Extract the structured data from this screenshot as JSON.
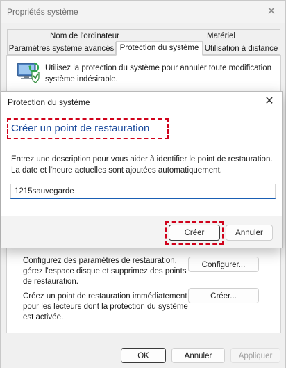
{
  "back_window": {
    "title": "Propriétés système",
    "tabs_row1": [
      "Nom de l'ordinateur",
      "Matériel"
    ],
    "tabs_row2": [
      "Paramètres système avancés",
      "Protection du système",
      "Utilisation à distance"
    ],
    "intro_text": "Utilisez la protection du système pour annuler toute modification système indésirable.",
    "restore_settings_text": "Configurez des paramètres de restauration, gérez l'espace disque et supprimez des points de restauration.",
    "configure_label": "Configurer...",
    "create_point_text": "Créez un point de restauration immédiatement pour les lecteurs dont la protection du système est activée.",
    "create_label": "Créer...",
    "ok_label": "OK",
    "cancel_label": "Annuler",
    "apply_label": "Appliquer"
  },
  "dialog": {
    "title": "Protection du système",
    "heading": "Créer un point de restauration",
    "instructions": "Entrez une description pour vous aider à identifier le point de restauration. La date et l'heure actuelles sont ajoutées automatiquement.",
    "input_value": "1215sauvegarde",
    "create_label": "Créer",
    "cancel_label": "Annuler"
  },
  "colors": {
    "heading": "#1a4a9c",
    "highlight": "#d0021b",
    "input_focus": "#1a5fb4"
  }
}
